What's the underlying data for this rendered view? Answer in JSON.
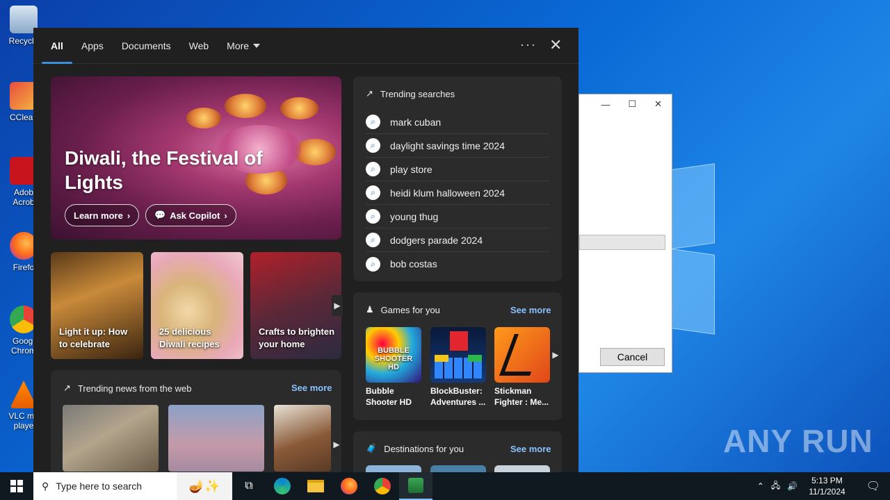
{
  "desktop": {
    "icons": [
      {
        "label": "Recycle",
        "icon": "recycle-bin-icon"
      },
      {
        "label": "CClean",
        "icon": "ccleaner-icon"
      },
      {
        "label": "Adob Acrob",
        "icon": "adobe-acrobat-icon"
      },
      {
        "label": "Firefo",
        "icon": "firefox-icon"
      },
      {
        "label": "Googl Chrom",
        "icon": "chrome-icon"
      },
      {
        "label": "VLC me playe",
        "icon": "vlc-icon"
      }
    ],
    "watermark": "ANY RUN"
  },
  "dialog": {
    "cancel_label": "Cancel"
  },
  "search_panel": {
    "tabs": [
      {
        "label": "All",
        "active": true
      },
      {
        "label": "Apps"
      },
      {
        "label": "Documents"
      },
      {
        "label": "Web"
      },
      {
        "label": "More"
      }
    ],
    "more_options": "···",
    "close": "✕",
    "hero": {
      "title": "Diwali, the Festival of Lights",
      "learn_more": "Learn more",
      "ask_copilot": "Ask Copilot"
    },
    "cards": [
      {
        "label": "Light it up: How to celebrate"
      },
      {
        "label": "25 delicious Diwali recipes"
      },
      {
        "label": "Crafts to brighten your home"
      }
    ],
    "trending_news": {
      "title": "Trending news from the web",
      "see_more": "See more"
    },
    "trending_searches": {
      "title": "Trending searches",
      "items": [
        "mark cuban",
        "daylight savings time 2024",
        "play store",
        "heidi klum halloween 2024",
        "young thug",
        "dodgers parade 2024",
        "bob costas"
      ]
    },
    "games": {
      "title": "Games for you",
      "see_more": "See more",
      "items": [
        {
          "name": "Bubble Shooter HD",
          "tile_text": "BUBBLE SHOOTER HD"
        },
        {
          "name": "BlockBuster: Adventures ..."
        },
        {
          "name": "Stickman Fighter : Me..."
        }
      ]
    },
    "destinations": {
      "title": "Destinations for you",
      "see_more": "See more"
    }
  },
  "taskbar": {
    "search_placeholder": "Type here to search",
    "time": "5:13 PM",
    "date": "11/1/2024"
  }
}
